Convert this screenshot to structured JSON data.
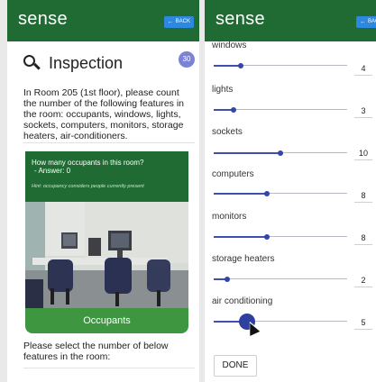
{
  "left": {
    "appbar": {
      "brand": "sense",
      "back_label": "BACK"
    },
    "title": "Inspection",
    "badge_count": "30",
    "instructions": "In Room 205 (1st floor), please count the number of the following features in the room: occupants, windows, lights, sockets, computers, monitors, storage heaters, air-conditioners.",
    "card": {
      "question": "How many occupants in this room?",
      "answer": " - Answer: 0",
      "hint": "Hint: occupancy considers people currently present",
      "label": "Occupants"
    },
    "select_text": "Please select the number of below features in the room:"
  },
  "right": {
    "appbar": {
      "brand": "sense",
      "back_label": "BACK"
    },
    "features": [
      {
        "label": "windows",
        "value": "4",
        "level": 0.2
      },
      {
        "label": "lights",
        "value": "3",
        "level": 0.15
      },
      {
        "label": "sockets",
        "value": "10",
        "level": 0.5
      },
      {
        "label": "computers",
        "value": "8",
        "level": 0.4
      },
      {
        "label": "monitors",
        "value": "8",
        "level": 0.4
      },
      {
        "label": "storage heaters",
        "value": "2",
        "level": 0.1
      },
      {
        "label": "air conditioning",
        "value": "5",
        "level": 0.25
      }
    ],
    "done_label": "DONE"
  },
  "colors": {
    "appbar": "#1f6b33",
    "card_label": "#3f9641",
    "back_button": "#2d88e0",
    "badge": "#7a83d6",
    "slider": "#3346a6"
  },
  "icons": {
    "search": "magnifier-icon",
    "back": "arrow-left-icon"
  }
}
